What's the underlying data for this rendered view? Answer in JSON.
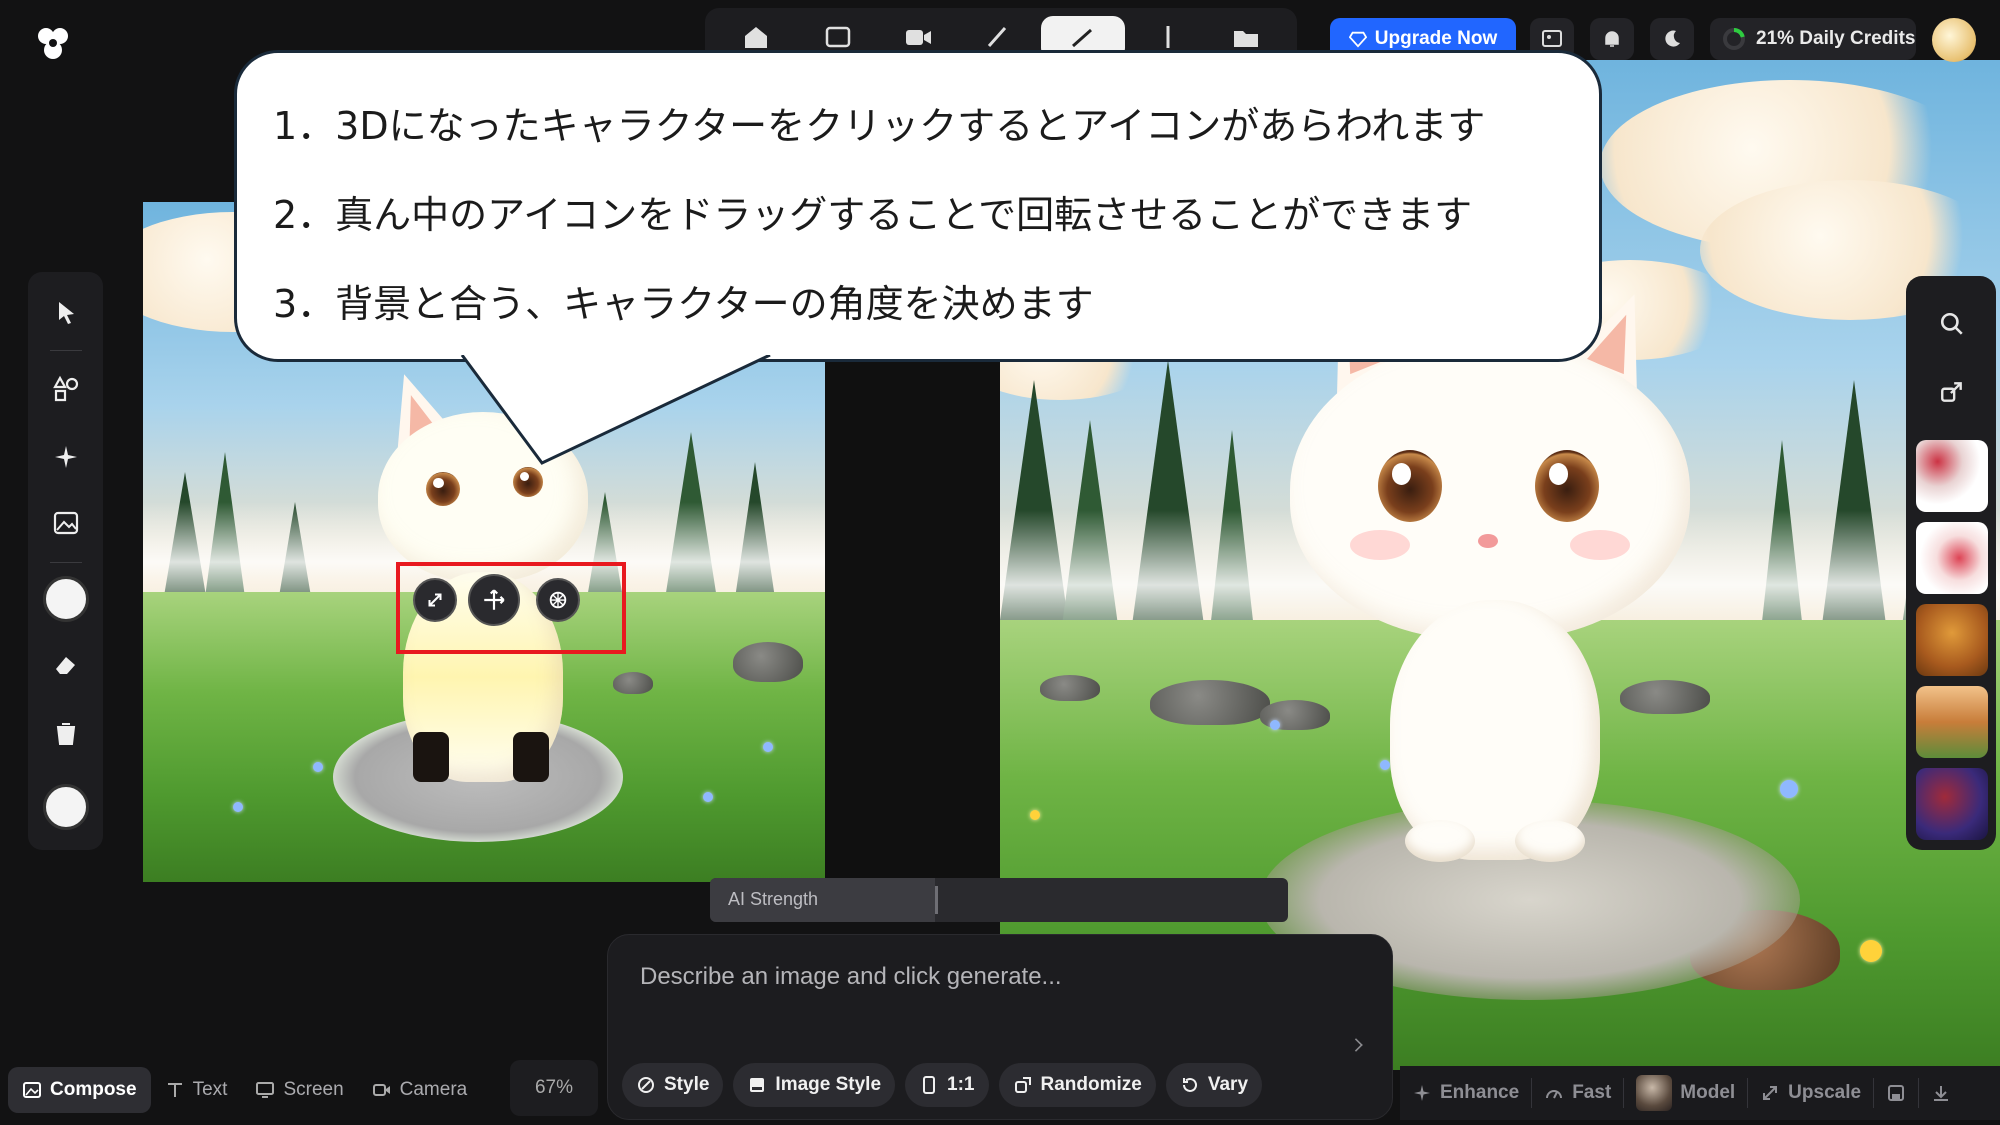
{
  "annotation": {
    "lines": [
      "1．3Dになったキャラクターをクリックするとアイコンがあらわれます",
      "2．真ん中のアイコンをドラッグすることで回転させることができます",
      "3．背景と合う、キャラクターの角度を決めます"
    ]
  },
  "header": {
    "upgrade_label": "Upgrade Now",
    "credits_label": "21% Daily Credits"
  },
  "strength": {
    "label": "AI Strength",
    "value": 0.39
  },
  "prompt": {
    "placeholder": "Describe an image and click generate..."
  },
  "prompt_pills": [
    {
      "label": "Style",
      "icon": "style-icon"
    },
    {
      "label": "Image Style",
      "icon": "image-style-icon"
    },
    {
      "label": "1:1",
      "icon": "aspect-ratio-icon"
    },
    {
      "label": "Randomize",
      "icon": "randomize-icon"
    },
    {
      "label": "Vary",
      "icon": "vary-icon"
    }
  ],
  "bottom_left": {
    "compose": "Compose",
    "text": "Text",
    "screen": "Screen",
    "camera": "Camera",
    "zoom": "67%"
  },
  "bottom_right": {
    "enhance": "Enhance",
    "fast": "Fast",
    "model": "Model",
    "upscale": "Upscale"
  },
  "colors": {
    "accent": "#2166ff",
    "highlight_box": "#e8191f",
    "panel": "#1d1d20"
  }
}
